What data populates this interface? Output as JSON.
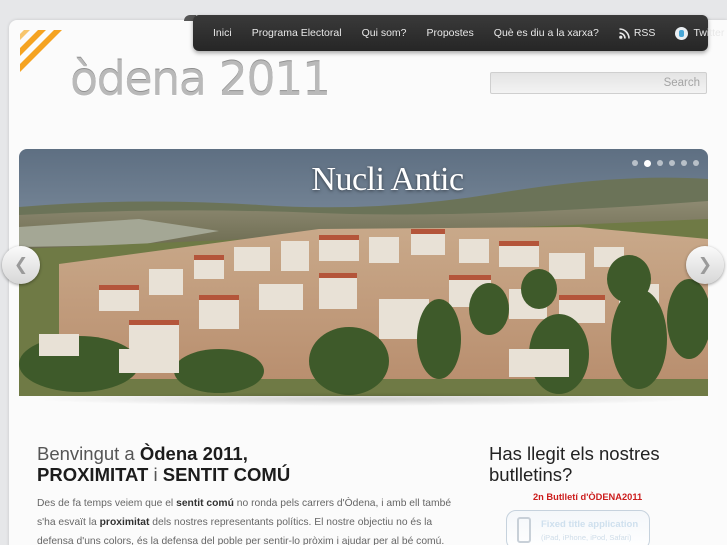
{
  "nav": {
    "items": [
      {
        "label": "Inici"
      },
      {
        "label": "Programa Electoral"
      },
      {
        "label": "Qui som?"
      },
      {
        "label": "Propostes"
      },
      {
        "label": "Què es diu a la xarxa?"
      },
      {
        "label": "RSS",
        "icon": "rss-icon"
      },
      {
        "label": "Twitter",
        "icon": "twitter-icon"
      }
    ]
  },
  "brand": {
    "name": "òdena 2011",
    "logo_colors": [
      "#f5a321",
      "#f7c56b"
    ]
  },
  "search": {
    "placeholder": "Search"
  },
  "slider": {
    "title": "Nucli Antic",
    "slide_count": 6,
    "active_index": 1,
    "prev_icon": "chevron-left-icon",
    "next_icon": "chevron-right-icon"
  },
  "welcome": {
    "line1_prefix": "Benvingut a ",
    "line1_bold": "Òdena 2011,",
    "line2_bold_a": "PROXIMITAT",
    "line2_mid": " i ",
    "line2_bold_b": "SENTIT COMÚ"
  },
  "intro": {
    "t1": "Des de fa temps veiem que el ",
    "b1": "sentit comú",
    "t2": " no ronda pels carrers d'Òdena, i amb ell també s'ha esvaït la ",
    "b2": "proximitat",
    "t3": " dels nostres representants polítics. El nostre objectiu no és la defensa d'uns colors, és la defensa del poble per sentir-lo pròxim i ajudar per al bé comú."
  },
  "sidebar": {
    "title": "Has llegit els nostres butlletins?",
    "bulletin_link": "2n Butlletí d'ÒDENA2011",
    "app_banner_line1": "Fixed title application",
    "app_banner_line2": "(iPad, iPhone, iPod, Safari)"
  },
  "colors": {
    "nav_bg": "#2e2e2e",
    "accent_orange": "#f5a321",
    "link_red": "#cc1d1d"
  }
}
